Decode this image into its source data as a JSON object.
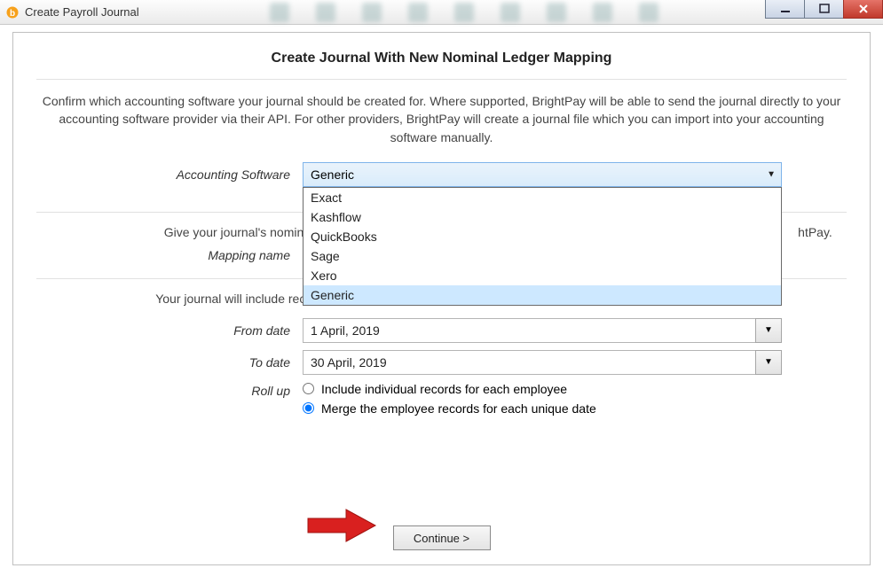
{
  "window": {
    "title": "Create Payroll Journal"
  },
  "heading": "Create Journal With New Nominal Ledger Mapping",
  "intro": "Confirm which accounting software your journal should be created for. Where supported, BrightPay will be able to send the journal directly to your accounting software provider via their API. For other providers, BrightPay will create a journal file which you can import into your accounting software manually.",
  "accounting_software": {
    "label": "Accounting Software",
    "selected": "Generic",
    "options": [
      "Exact",
      "Kashflow",
      "QuickBooks",
      "Sage",
      "Xero",
      "Generic"
    ],
    "highlighted_index": 5
  },
  "mapping_section": {
    "text_left": "Give your journal's nominal",
    "text_right": "htPay.",
    "label": "Mapping name"
  },
  "range_text": "Your journal will include records for all payslips finalised with a pay date within the selected range below.",
  "from_date": {
    "label": "From date",
    "value": "1 April, 2019"
  },
  "to_date": {
    "label": "To date",
    "value": "30 April, 2019"
  },
  "rollup": {
    "label": "Roll up",
    "options": [
      "Include individual records for each employee",
      "Merge the employee records for each unique date"
    ],
    "selected_index": 1
  },
  "continue_label": "Continue >"
}
